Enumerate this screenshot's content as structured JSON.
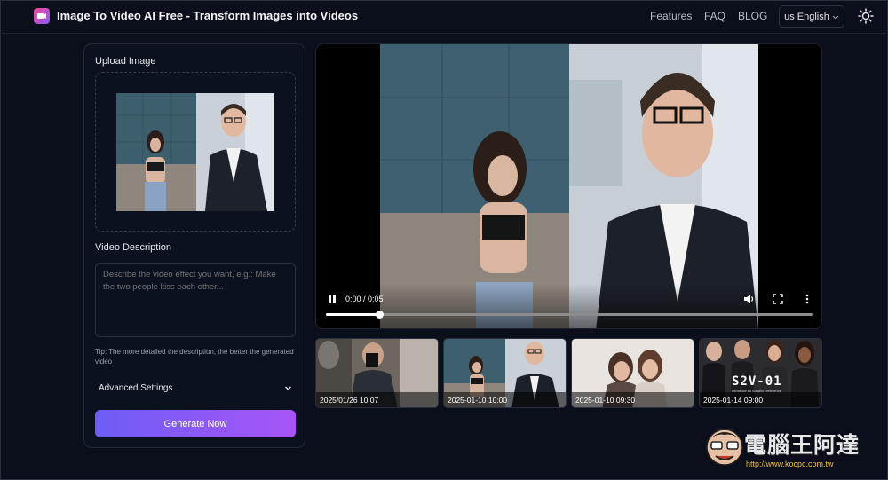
{
  "header": {
    "title": "Image To Video AI Free - Transform Images into Videos",
    "nav": [
      "Features",
      "FAQ",
      "BLOG"
    ],
    "language": "us English",
    "logo_icon": "video-play-icon",
    "theme_icon": "sun-icon"
  },
  "left_panel": {
    "upload_label": "Upload Image",
    "description_label": "Video Description",
    "description_placeholder": "Describe the video effect you want, e.g.: Make the two people kiss each other...",
    "description_value": "",
    "tip": "Tip: The more detailed the description, the better the generated video",
    "advanced_settings": "Advanced Settings",
    "generate_button": "Generate Now"
  },
  "video": {
    "time": "0:00 / 0:05",
    "progress_fraction": 0.11
  },
  "history": [
    {
      "timestamp": "2025/01/26 10:07"
    },
    {
      "timestamp": "2025-01-10 10:00"
    },
    {
      "timestamp": "2025-01-10 09:30"
    },
    {
      "timestamp": "2025-01-14 09:00",
      "overlay_title": "S2V-01",
      "overlay_subtitle": "Introduce all Subject Reference"
    }
  ],
  "watermark": {
    "text": "電腦王阿達",
    "url": "http://www.kocpc.com.tw"
  },
  "colors": {
    "background": "#0b0f1c",
    "accent_start": "#6d5df5",
    "accent_end": "#a855f7",
    "logo": "#ec4899"
  }
}
